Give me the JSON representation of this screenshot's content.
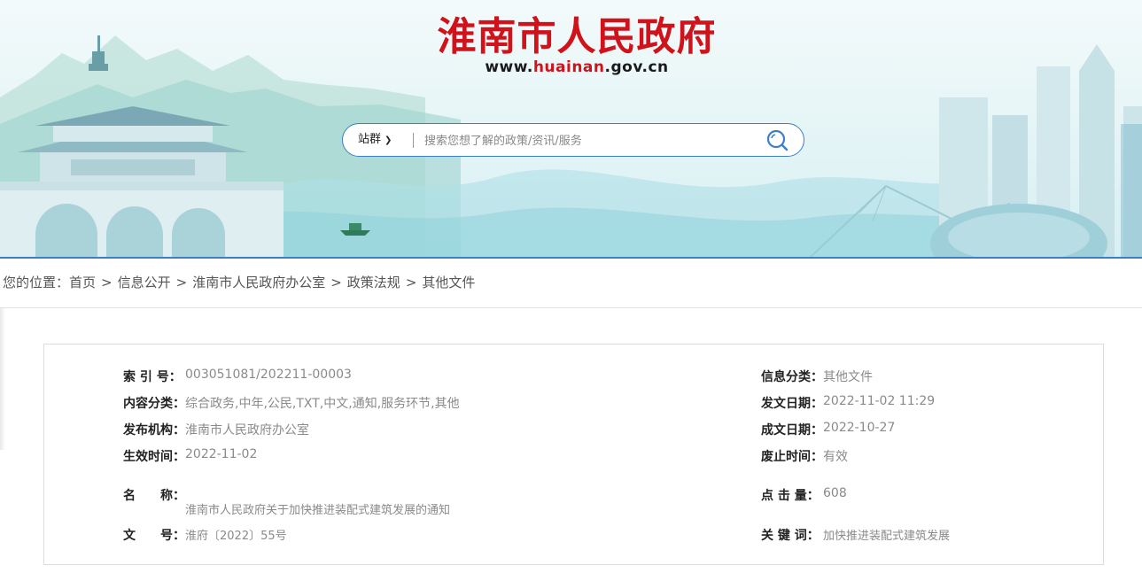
{
  "header": {
    "site_title": "淮南市人民政府",
    "site_url_prefix": "www.",
    "site_url_highlight": "huainan",
    "site_url_suffix": ".gov.cn",
    "title_color": "#d0121b",
    "accent_color": "#3b7fc4"
  },
  "search": {
    "scope_label": "站群",
    "placeholder": "搜索您想了解的政策/资讯/服务",
    "icon": "search-icon"
  },
  "breadcrumb": {
    "prefix": "您的位置：",
    "items": [
      "首页",
      "信息公开",
      "淮南市人民政府办公室",
      "政策法规",
      "其他文件"
    ],
    "separator": ">"
  },
  "doc_info": {
    "index_no": {
      "label": "索 引 号：",
      "value": "003051081/202211-00003"
    },
    "category": {
      "label": "信息分类：",
      "value": "其他文件"
    },
    "content_class": {
      "label": "内容分类：",
      "value": "综合政务,中年,公民,TXT,中文,通知,服务环节,其他"
    },
    "issue_date": {
      "label": "发文日期：",
      "value": "2022-11-02 11:29"
    },
    "publisher": {
      "label": "发布机构：",
      "value": "淮南市人民政府办公室"
    },
    "written_date": {
      "label": "成文日期：",
      "value": "2022-10-27"
    },
    "effective_date": {
      "label": "生效时间：",
      "value": "2022-11-02"
    },
    "expiry": {
      "label": "废止时间：",
      "value": "有效"
    },
    "name": {
      "label_a": "名",
      "label_b": "称：",
      "value": "淮南市人民政府关于加快推进装配式建筑发展的通知"
    },
    "clicks": {
      "label": "点 击 量：",
      "value": "608"
    },
    "doc_no": {
      "label_a": "文",
      "label_b": "号：",
      "value": "淮府〔2022〕55号"
    },
    "keywords": {
      "label": "关 键 词：",
      "value": "加快推进装配式建筑发展"
    }
  }
}
